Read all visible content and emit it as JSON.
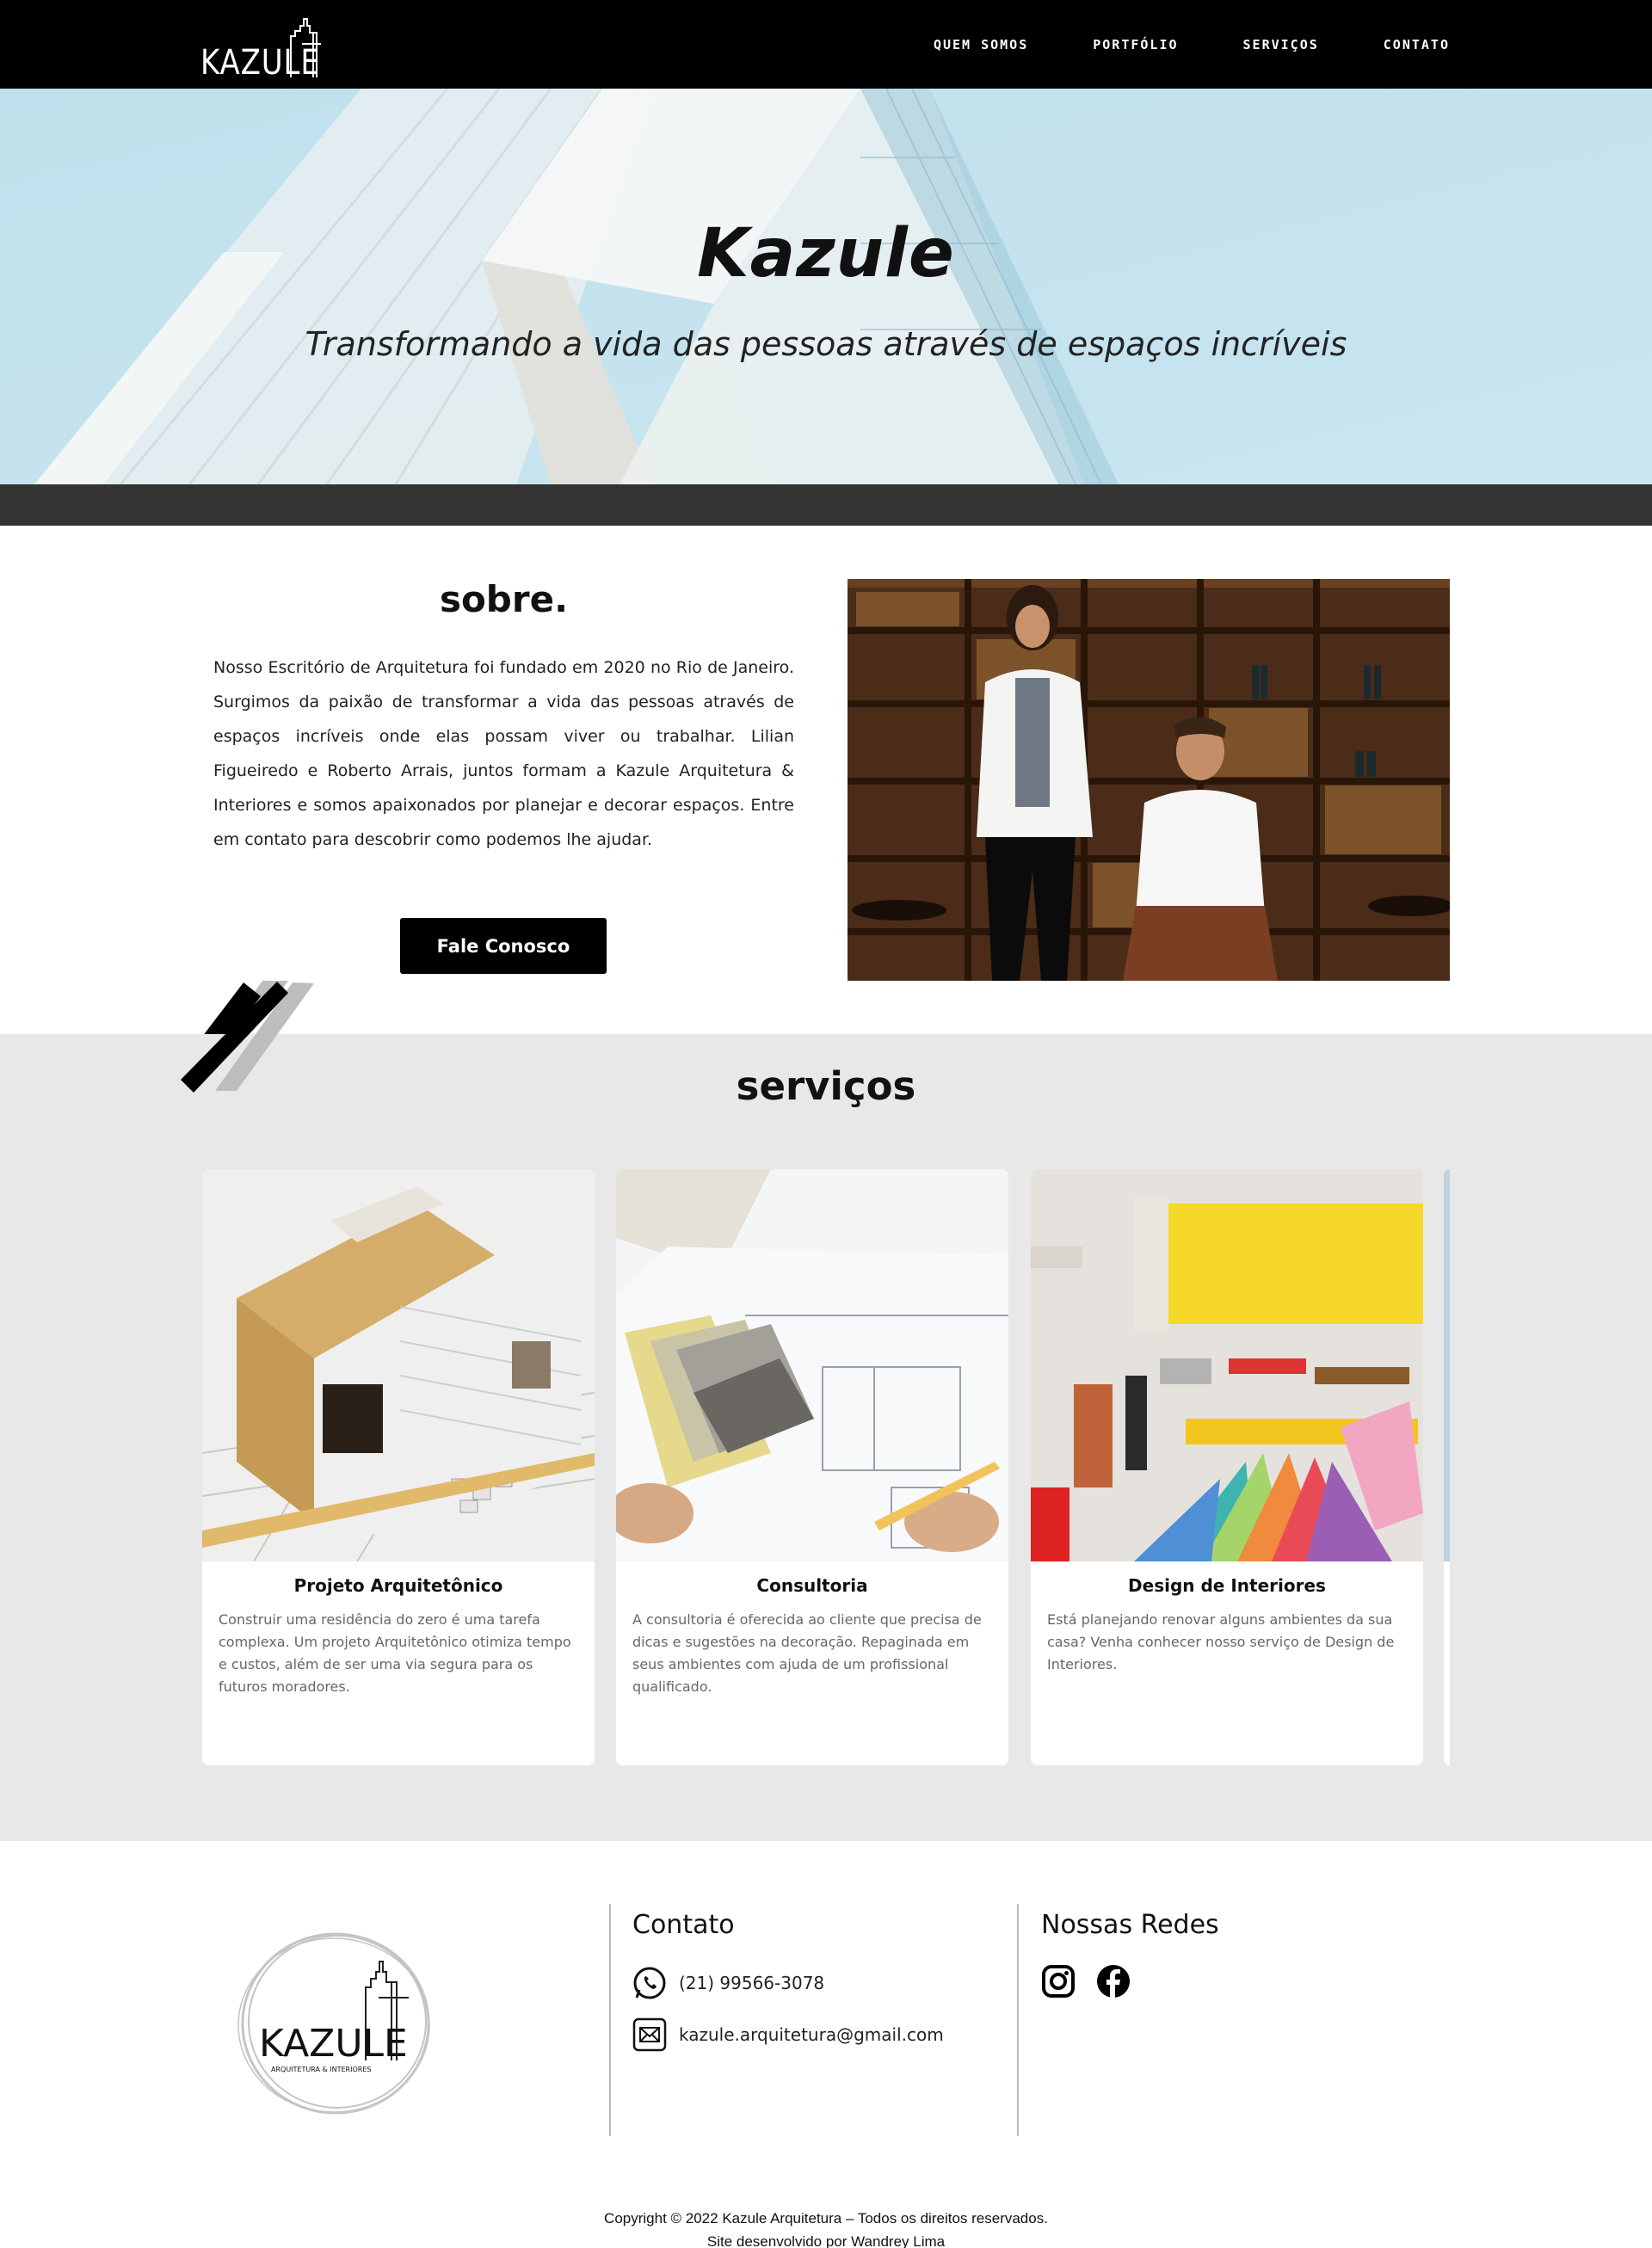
{
  "header": {
    "logo_text": "KAZULE",
    "nav": [
      "QUEM SOMOS",
      "PORTFÓLIO",
      "SERVIÇOS",
      "CONTATO"
    ]
  },
  "hero": {
    "title": "Kazule",
    "subtitle": "Transformando a vida das pessoas através de espaços incríveis"
  },
  "sobre": {
    "title": "sobre.",
    "text": "Nosso Escritório de Arquitetura foi fundado em 2020 no Rio de Janeiro. Surgimos da paixão de transformar a vida das pessoas através de espaços incríveis onde elas possam viver ou trabalhar. Lilian Figueiredo e Roberto Arrais, juntos formam a Kazule Arquitetura & Interiores e somos apaixonados por planejar e decorar espaços. Entre em contato para descobrir como podemos lhe ajudar.",
    "button": "Fale Conosco"
  },
  "servicos": {
    "title": "serviços",
    "cards": [
      {
        "title": "Projeto Arquitetônico",
        "description": "Construir uma residência do zero é uma tarefa complexa. Um projeto Arquitetônico otimiza tempo e custos, além de ser uma via segura para os futuros moradores."
      },
      {
        "title": "Consultoria",
        "description": "A consultoria é oferecida ao cliente que precisa de dicas e sugestões na decoração. Repaginada em seus ambientes com ajuda de um profissional qualificado."
      },
      {
        "title": "Design de Interiores",
        "description": "Está planejando renovar alguns ambientes da sua casa? Venha conhecer nosso serviço de Design de Interiores."
      }
    ]
  },
  "footer": {
    "logo_text": "KAZULE",
    "logo_tagline": "ARQUITETURA & INTERIORES",
    "contato_title": "Contato",
    "phone": "(21) 99566-3078",
    "email": "kazule.arquitetura@gmail.com",
    "redes_title": "Nossas Redes",
    "copyright": "Copyright © 2022 Kazule Arquitetura – Todos os direitos reservados.",
    "credit": "Site desenvolvido por Wandrey Lima"
  },
  "icons": [
    "building-icon",
    "whatsapp-icon",
    "email-icon",
    "instagram-icon",
    "facebook-icon"
  ],
  "colors": {
    "header_bg": "#000000",
    "hero_sky": "#c5e4ef",
    "band": "#333333",
    "services_bg": "#e8e8e8",
    "button_bg": "#000000"
  }
}
